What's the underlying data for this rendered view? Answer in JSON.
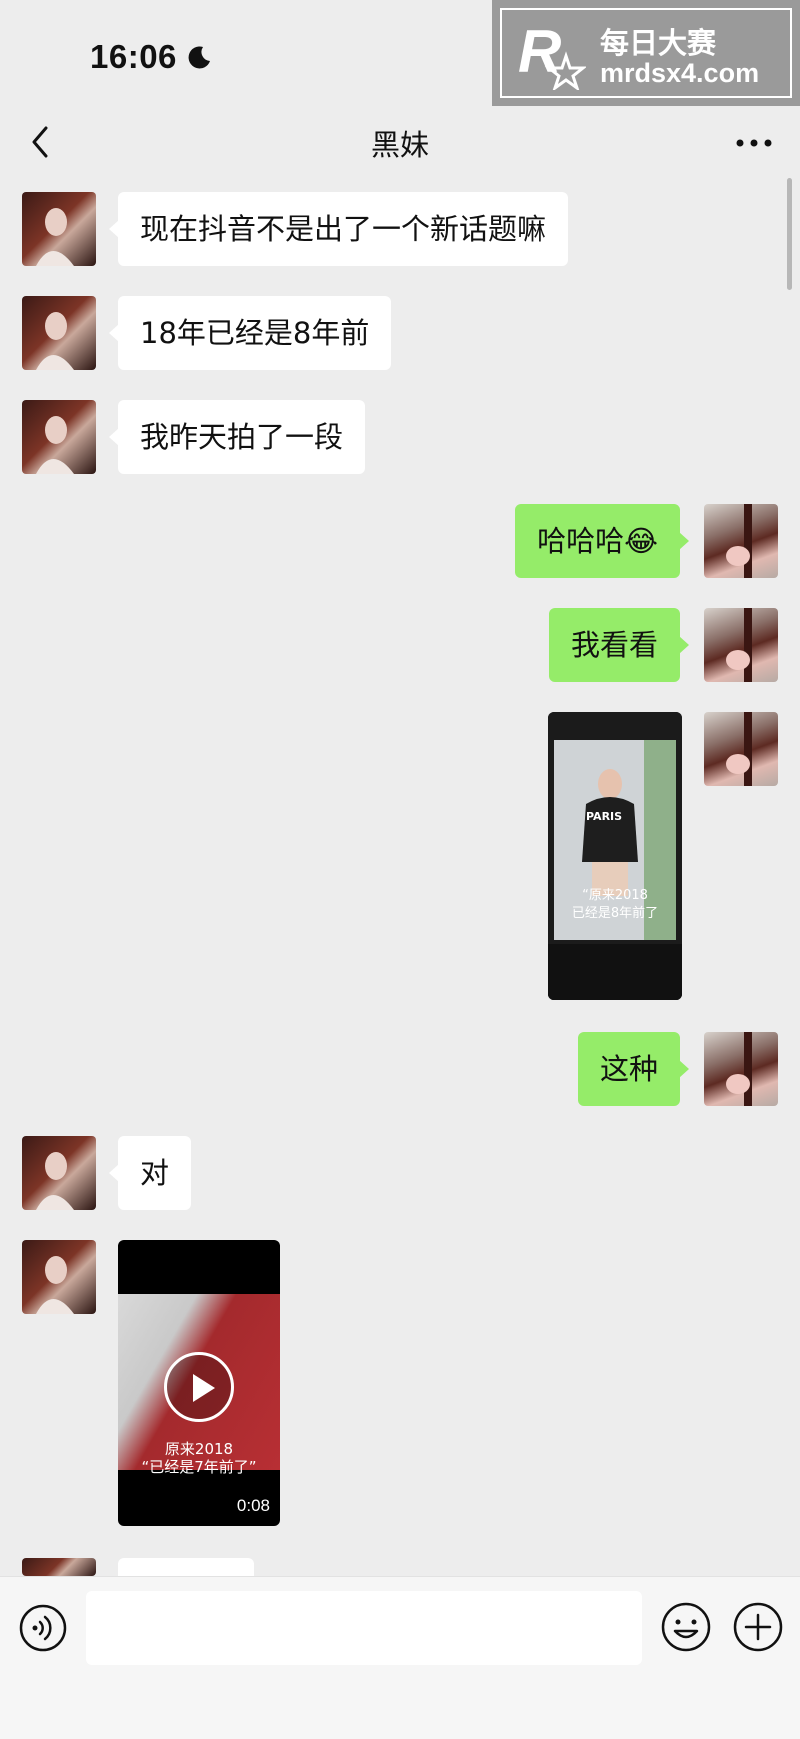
{
  "status_bar": {
    "time": "16:06"
  },
  "watermark": {
    "title": "每日大赛",
    "site": "mrdsx4.com",
    "logo_text": "每日大赛"
  },
  "nav": {
    "title": "黑妹"
  },
  "messages": [
    {
      "sender": "her",
      "type": "text",
      "text": "现在抖音不是出了一个新话题嘛"
    },
    {
      "sender": "her",
      "type": "text",
      "text": "18年已经是8年前"
    },
    {
      "sender": "her",
      "type": "text",
      "text": "我昨天拍了一段"
    },
    {
      "sender": "me",
      "type": "text",
      "text": "哈哈哈😂"
    },
    {
      "sender": "me",
      "type": "text",
      "text": "我看看"
    },
    {
      "sender": "me",
      "type": "image",
      "shirt_text": "PARIS",
      "caption_line1": "“原来2018",
      "caption_line2": "已经是8年前了"
    },
    {
      "sender": "me",
      "type": "text",
      "text": "这种"
    },
    {
      "sender": "her",
      "type": "text",
      "text": "对"
    },
    {
      "sender": "her",
      "type": "video",
      "caption_line1": "原来2018",
      "caption_line2": "“已经是7年前了”",
      "duration": "0:08"
    }
  ],
  "colors": {
    "background": "#ededed",
    "incoming_bubble": "#ffffff",
    "outgoing_bubble": "#95ec69"
  },
  "icons": [
    "moon-icon",
    "back-icon",
    "more-icon",
    "voice-icon",
    "emoji-icon",
    "plus-icon",
    "play-icon"
  ]
}
